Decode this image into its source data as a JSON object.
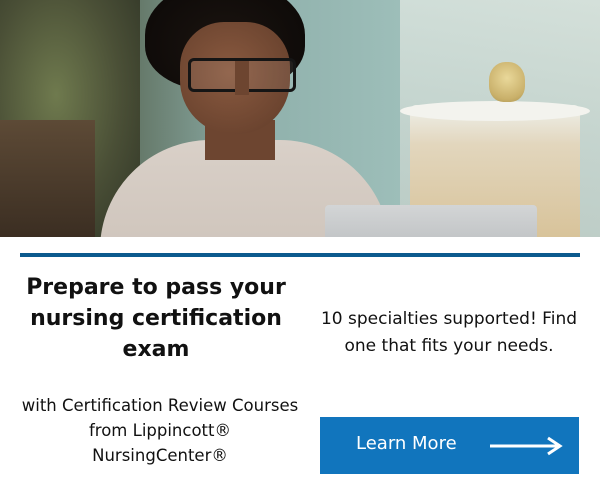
{
  "hero_image": {
    "alt": "",
    "icon": "photo-woman-laptop"
  },
  "headline": "Prepare to pass your nursing certification exam",
  "subhead": "with Certification Review Courses from Lippincott® NursingCenter®",
  "tagline": "10 specialties supported! Find one that fits your needs.",
  "cta": {
    "label": "Learn More",
    "icon": "arrow-right-icon"
  },
  "colors": {
    "accent_rule": "#0c5a8e",
    "button": "#1175bd",
    "button_text": "#ffffff",
    "text": "#111111"
  }
}
